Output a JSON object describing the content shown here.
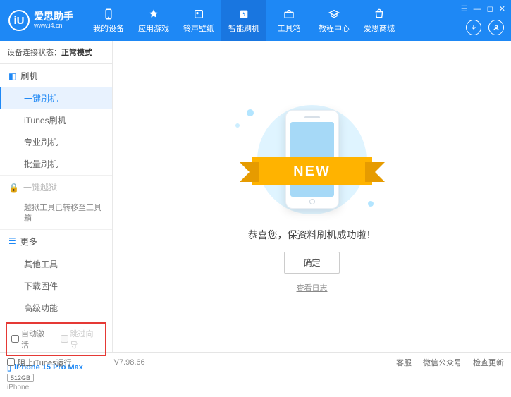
{
  "header": {
    "logo_letter": "iU",
    "app_name": "爱思助手",
    "site": "www.i4.cn",
    "nav": [
      {
        "label": "我的设备"
      },
      {
        "label": "应用游戏"
      },
      {
        "label": "铃声壁纸"
      },
      {
        "label": "智能刷机"
      },
      {
        "label": "工具箱"
      },
      {
        "label": "教程中心"
      },
      {
        "label": "爱思商城"
      }
    ],
    "win_controls": [
      "☰",
      "—",
      "◻",
      "✕"
    ]
  },
  "sidebar": {
    "status_label": "设备连接状态：",
    "status_value": "正常模式",
    "sections": {
      "flash": {
        "title": "刷机",
        "items": [
          "一键刷机",
          "iTunes刷机",
          "专业刷机",
          "批量刷机"
        ]
      },
      "jailbreak": {
        "title": "一键越狱",
        "info": "越狱工具已转移至工具箱"
      },
      "more": {
        "title": "更多",
        "items": [
          "其他工具",
          "下载固件",
          "高级功能"
        ]
      }
    },
    "checkboxes": {
      "auto_activate": "自动激活",
      "skip_guide": "跳过向导"
    },
    "device": {
      "name": "iPhone 15 Pro Max",
      "storage": "512GB",
      "type": "iPhone"
    }
  },
  "main": {
    "ribbon": "NEW",
    "message": "恭喜您，保资料刷机成功啦！",
    "ok": "确定",
    "log": "查看日志"
  },
  "footer": {
    "block_itunes": "阻止iTunes运行",
    "version": "V7.98.66",
    "links": [
      "客服",
      "微信公众号",
      "检查更新"
    ]
  }
}
